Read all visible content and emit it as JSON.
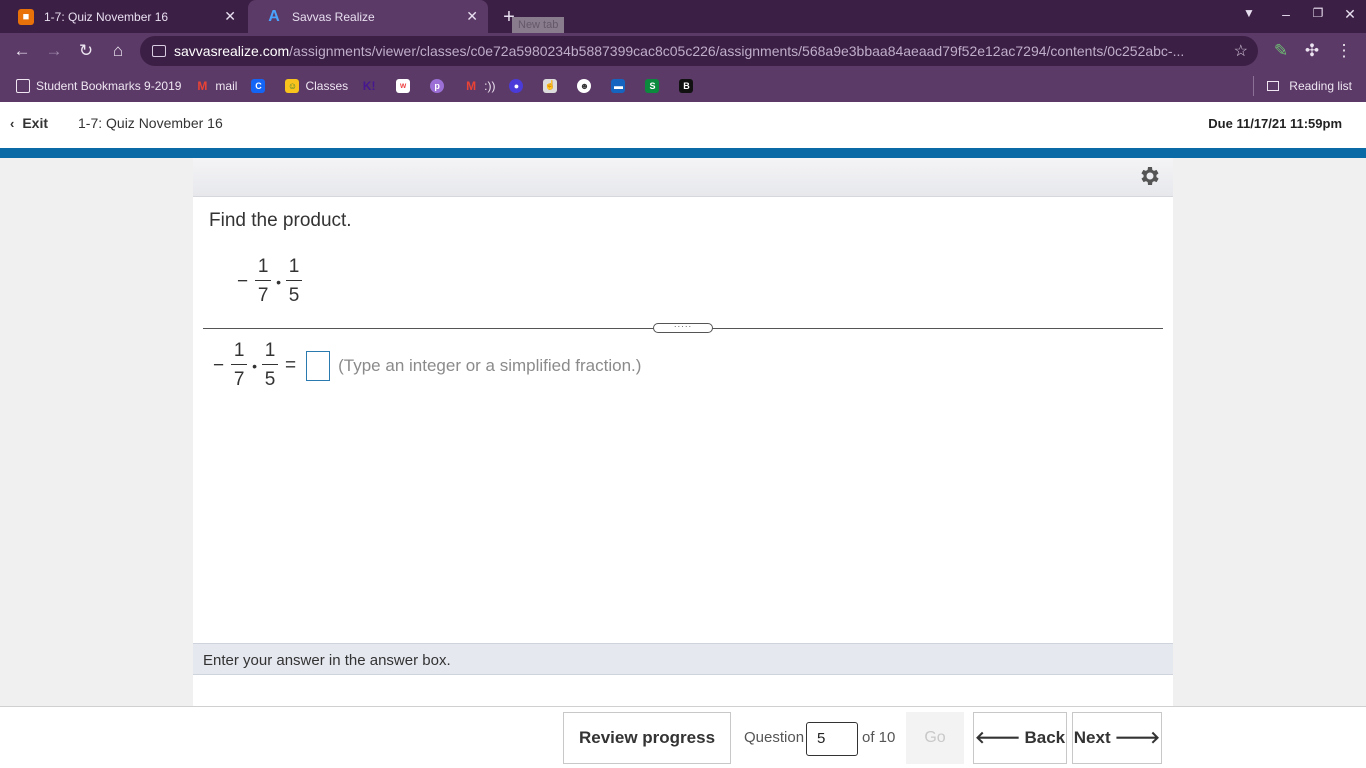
{
  "browser": {
    "tabs": [
      {
        "title": "1-7: Quiz November 16",
        "favicon": "assignment-icon",
        "active": false
      },
      {
        "title": "Savvas Realize",
        "favicon": "savvas-icon",
        "active": true
      }
    ],
    "new_tab_tooltip": "New tab",
    "url_host": "savvasrealize.com",
    "url_path": "/assignments/viewer/classes/c0e72a5980234b5887399cac8c05c226/assignments/568a9e3bbaa84aeaad79f52e12ac7294/contents/0c252abc-...",
    "bookmarks": [
      {
        "label": "Student Bookmarks 9-2019",
        "icon": "folder-icon"
      },
      {
        "label": "mail",
        "icon": "gmail-icon"
      },
      {
        "label": "",
        "icon": "clever-icon"
      },
      {
        "label": "Classes",
        "icon": "classroom-icon"
      },
      {
        "label": "",
        "icon": "kahoot-icon"
      },
      {
        "label": "",
        "icon": "bookmark-icon"
      },
      {
        "label": "",
        "icon": "bookmark-icon"
      },
      {
        "label": ":))",
        "icon": "gmail-icon"
      },
      {
        "label": "",
        "icon": "bookmark-icon"
      },
      {
        "label": "",
        "icon": "bookmark-icon"
      },
      {
        "label": "",
        "icon": "bookmark-icon"
      },
      {
        "label": "",
        "icon": "bookmark-icon"
      },
      {
        "label": "",
        "icon": "bookmark-icon"
      },
      {
        "label": "",
        "icon": "bookmark-icon"
      }
    ],
    "reading_list": "Reading list",
    "colors": {
      "frame": "#3c1f45",
      "toolbar": "#5b3a67"
    }
  },
  "header": {
    "exit_label": "Exit",
    "quiz_title": "1-7: Quiz November 16",
    "due": "Due 11/17/21 11:59pm"
  },
  "question": {
    "prompt": "Find the product.",
    "expression": {
      "sign": "−",
      "frac1": {
        "num": "1",
        "den": "7"
      },
      "operator": "•",
      "frac2": {
        "num": "1",
        "den": "5"
      }
    },
    "equals": "=",
    "answer_value": "",
    "hint": "(Type an integer or a simplified fraction.)",
    "status": "Enter your answer in the answer box."
  },
  "footer": {
    "review_label": "Review progress",
    "question_label": "Question",
    "question_number": "5",
    "of_label": "of 10",
    "go_label": "Go",
    "back_label": "Back",
    "next_label": "Next"
  },
  "colors": {
    "accent_blue": "#0a6aa6",
    "answer_border": "#2a7ab0"
  }
}
